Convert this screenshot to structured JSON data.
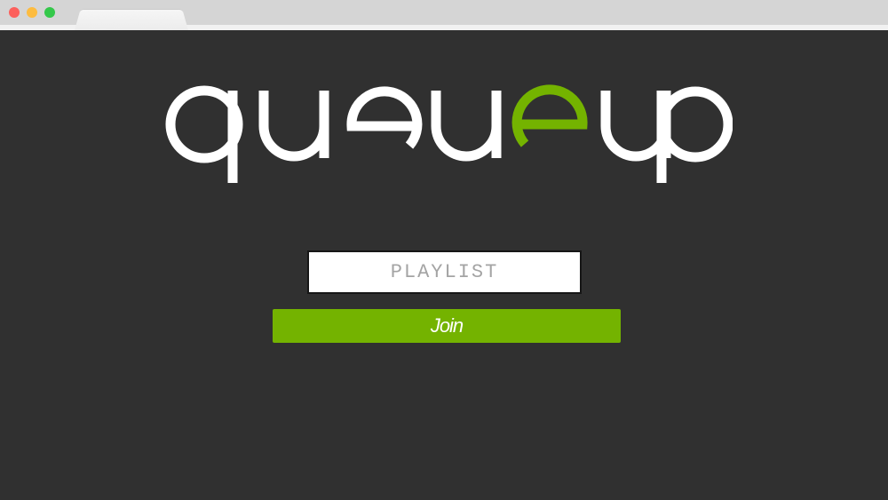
{
  "app": {
    "logo_text": "queueup",
    "accent_color": "#74b300",
    "background_color": "#303030"
  },
  "form": {
    "playlist_placeholder": "PLAYLIST",
    "playlist_value": "",
    "join_label": "Join"
  },
  "icons": {
    "logo": "queueup-wordmark"
  }
}
